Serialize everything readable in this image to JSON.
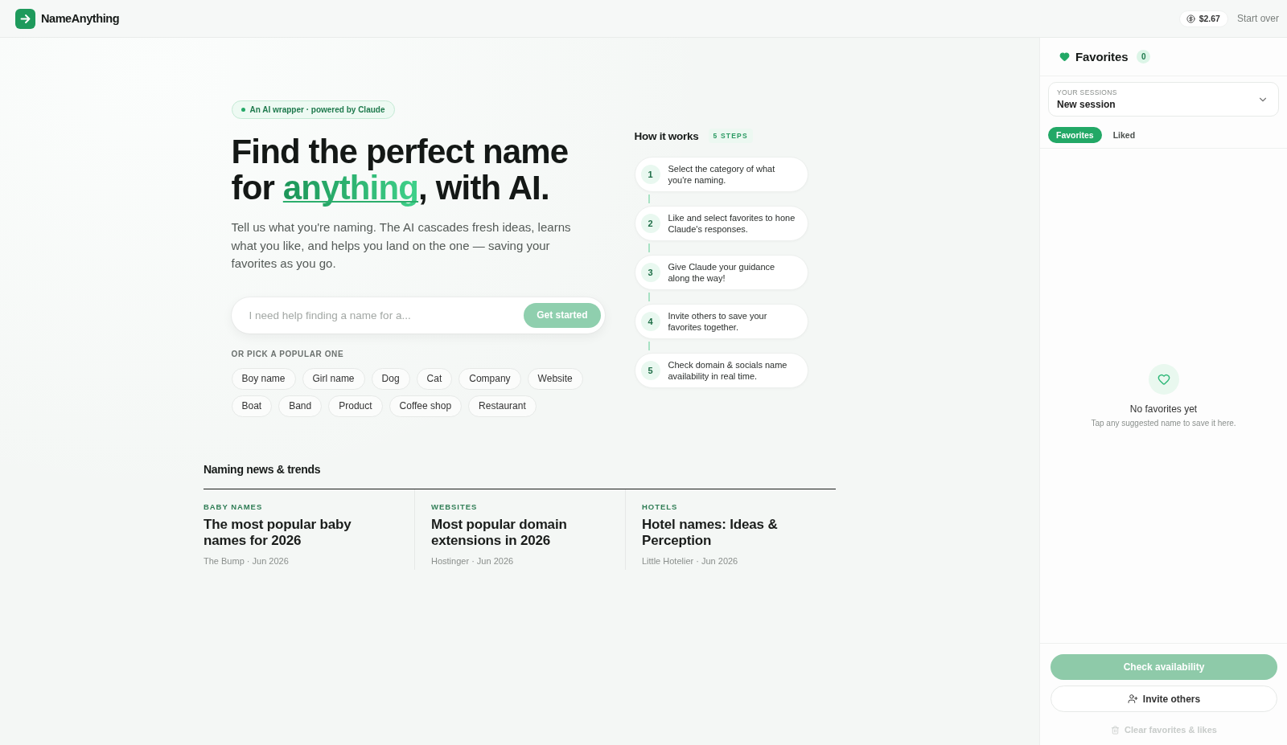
{
  "header": {
    "logo": "NameAnything",
    "credit": "$2.67",
    "start_over": "Start over"
  },
  "hero": {
    "badge": "An AI wrapper · powered by Claude",
    "headline": "Find the perfect name for *anything*, with AI.",
    "intro": "Tell us what you're naming. The AI cascades fresh ideas, learns what you like, and helps you land on the one — saving your favorites as you go.",
    "search": {
      "placeholder": "I need help finding a name for a...",
      "button": {
        "label": "Get started",
        "disabled": true
      }
    },
    "popular_label": "OR PICK A POPULAR ONE",
    "popular": [
      "Boy name",
      "Girl name",
      "Dog",
      "Cat",
      "Company",
      "Website",
      "Boat",
      "Band",
      "Product",
      "Coffee shop",
      "Restaurant"
    ]
  },
  "how_it_works": {
    "title": "How it works",
    "badge": "5 STEPS",
    "steps": [
      {
        "number": "1",
        "text": "Select the category of what you're naming."
      },
      {
        "number": "2",
        "text": "Like and select favorites to hone Claude's responses."
      },
      {
        "number": "3",
        "text": "Give Claude your guidance along the way!"
      },
      {
        "number": "4",
        "text": "Invite others to save your favorites together."
      },
      {
        "number": "5",
        "text": "Check domain & socials name availability in real time."
      }
    ]
  },
  "news": {
    "title": "Naming news & trends",
    "articles": [
      {
        "category": "BABY NAMES",
        "title": "The most popular baby names for 2026",
        "meta": "The Bump · Jun 2026"
      },
      {
        "category": "WEBSITES",
        "title": "Most popular domain extensions in 2026",
        "meta": "Hostinger · Jun 2026"
      },
      {
        "category": "HOTELS",
        "title": "Hotel names: Ideas & Perception",
        "meta": "Little Hotelier · Jun 2026"
      }
    ]
  },
  "sidebar": {
    "title": "Favorites",
    "count": "0",
    "sessions": {
      "label": "YOUR SESSIONS",
      "value": "New session"
    },
    "tabs": [
      {
        "label": "Favorites",
        "selected": true
      },
      {
        "label": "Liked",
        "selected": false
      }
    ],
    "empty": {
      "title": "No favorites yet",
      "hint": "Tap any suggested name to save it here."
    },
    "actions": [
      {
        "kind": "primary",
        "label": "Check availability",
        "disabled": true
      },
      {
        "kind": "secondary",
        "label": "Invite others",
        "disabled": false
      },
      {
        "kind": "link",
        "label": "Clear favorites & likes",
        "disabled": true
      }
    ]
  }
}
